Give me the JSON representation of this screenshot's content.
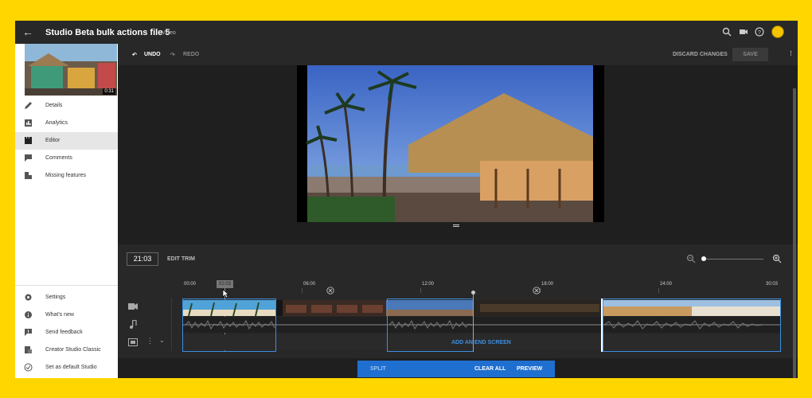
{
  "header": {
    "title": "Studio Beta bulk actions file 5",
    "subtitle": "Video"
  },
  "thumbnail": {
    "duration": "0:31"
  },
  "sidebar": {
    "items": [
      {
        "label": "Details",
        "icon": "pencil-icon"
      },
      {
        "label": "Analytics",
        "icon": "analytics-icon"
      },
      {
        "label": "Editor",
        "icon": "clapper-icon",
        "active": true
      },
      {
        "label": "Comments",
        "icon": "comment-icon"
      },
      {
        "label": "Missing features",
        "icon": "missing-icon"
      }
    ],
    "bottom_items": [
      {
        "label": "Settings",
        "icon": "gear-icon"
      },
      {
        "label": "What's new",
        "icon": "info-icon"
      },
      {
        "label": "Send feedback",
        "icon": "feedback-icon"
      },
      {
        "label": "Creator Studio Classic",
        "icon": "classic-icon"
      },
      {
        "label": "Set as default Studio",
        "icon": "check-circle-icon"
      }
    ]
  },
  "toolbar": {
    "undo": "UNDO",
    "redo": "REDO",
    "discard": "DISCARD CHANGES",
    "save": "SAVE"
  },
  "editor": {
    "current_time": "21:03",
    "edit_trim": "EDIT TRIM",
    "playhead": "02:03",
    "ticks": [
      "00:00",
      "06:00",
      "12:00",
      "18:00",
      "24:00",
      "30:03"
    ],
    "end_screen": "ADD AN END SCREEN"
  },
  "actions": {
    "split": "SPLIT",
    "clear_all": "CLEAR ALL",
    "preview": "PREVIEW"
  },
  "colors": {
    "frame": "#ffd600",
    "accent": "#3d8fe0",
    "action_bar": "#1e6fcf"
  }
}
